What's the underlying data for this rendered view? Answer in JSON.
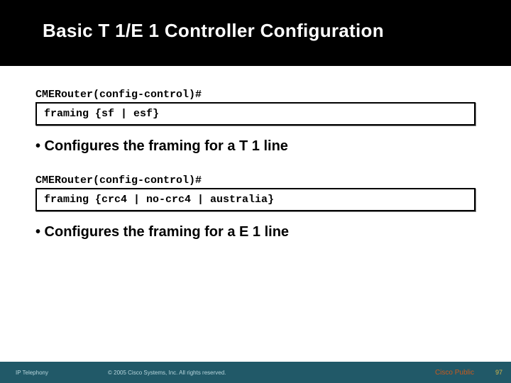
{
  "header": {
    "title": "Basic T 1/E 1 Controller Configuration"
  },
  "sections": {
    "prompt1": "CMERouter(config-control)#",
    "code1": "framing {sf | esf}",
    "bullet1": "• Configures the framing for a T 1 line",
    "prompt2": "CMERouter(config-control)#",
    "code2": "framing {crc4 | no-crc4 | australia}",
    "bullet2": "• Configures the framing for a E 1 line"
  },
  "footer": {
    "left": "IP Telephony",
    "center": "© 2005 Cisco Systems, Inc. All rights reserved.",
    "right": "Cisco Public",
    "pagenum": "97"
  }
}
